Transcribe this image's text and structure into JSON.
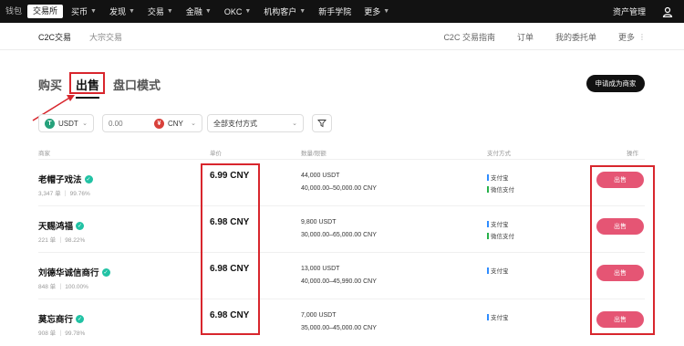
{
  "topbar": {
    "mode_tabs": [
      "钱包",
      "交易所"
    ],
    "nav": [
      {
        "label": "买币",
        "has_caret": true
      },
      {
        "label": "发现",
        "has_caret": true
      },
      {
        "label": "交易",
        "has_caret": true
      },
      {
        "label": "金融",
        "has_caret": true
      },
      {
        "label": "OKC",
        "has_caret": true
      },
      {
        "label": "机构客户",
        "has_caret": true
      },
      {
        "label": "新手学院",
        "has_caret": false
      },
      {
        "label": "更多",
        "has_caret": true
      }
    ],
    "asset_label": "资产管理",
    "user_icon": "user-icon"
  },
  "subnav": {
    "tabs": [
      "C2C交易",
      "大宗交易"
    ],
    "right_links": [
      "C2C 交易指南",
      "订单",
      "我的委托单",
      "更多"
    ]
  },
  "main_tabs": [
    "购买",
    "出售",
    "盘口模式"
  ],
  "apply_merchant_label": "申请成为商家",
  "filters": {
    "coin": "USDT",
    "amount_placeholder": "0.00",
    "currency": "CNY",
    "payment": "全部支付方式"
  },
  "table": {
    "headers": [
      "商家",
      "单价",
      "数量/限额",
      "支付方式",
      "操作"
    ],
    "rows": [
      {
        "merchant": "老帽子戏法",
        "stats": "3,347 单 ｜ 99.76%",
        "price": "6.99 CNY",
        "quantity": "44,000 USDT",
        "limits": "40,000.00–50,000.00 CNY",
        "payments": [
          "支付宝",
          "微信支付"
        ],
        "action": "出售"
      },
      {
        "merchant": "天赐鸿福",
        "stats": "221 单 ｜ 98.22%",
        "price": "6.98 CNY",
        "quantity": "9,800 USDT",
        "limits": "30,000.00–65,000.00 CNY",
        "payments": [
          "支付宝",
          "微信支付"
        ],
        "action": "出售"
      },
      {
        "merchant": "刘德华诚信商行",
        "stats": "848 单 ｜ 100.00%",
        "price": "6.98 CNY",
        "quantity": "13,000 USDT",
        "limits": "40,000.00–45,990.00 CNY",
        "payments": [
          "支付宝"
        ],
        "action": "出售"
      },
      {
        "merchant": "莫忘商行",
        "stats": "908 单 ｜ 99.78%",
        "price": "6.98 CNY",
        "quantity": "7,000 USDT",
        "limits": "35,000.00–45,000.00 CNY",
        "payments": [
          "支付宝"
        ],
        "action": "出售"
      }
    ]
  },
  "colors": {
    "sell_button": "#e55574",
    "highlight": "#d8262d",
    "usdt": "#26a17b",
    "cny": "#d8403a",
    "verified": "#21c2a4"
  }
}
